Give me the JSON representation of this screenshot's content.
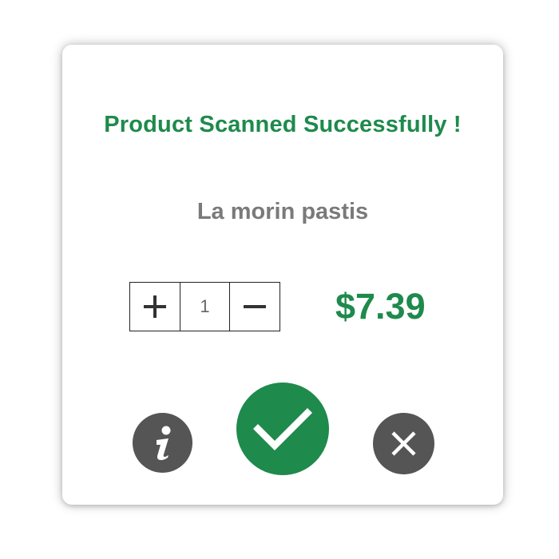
{
  "dialog": {
    "title": "Product Scanned Successfully !",
    "product_name": "La morin pastis",
    "quantity": "1",
    "price": "$7.39"
  },
  "icons": {
    "increment": "plus-icon",
    "decrement": "minus-icon",
    "info": "info-icon",
    "confirm": "checkmark-icon",
    "close": "close-icon"
  },
  "colors": {
    "accent_green": "#1e8a4c",
    "product_gray": "#7a7a7a",
    "button_gray": "#555555"
  }
}
